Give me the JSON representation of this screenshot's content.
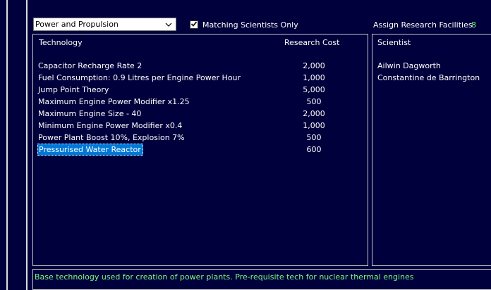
{
  "filter": {
    "selected": "Power and Propulsion",
    "matching_only_checked": true,
    "matching_only_label": "Matching Scientists Only"
  },
  "facilities": {
    "label": "Assign Research Facilities",
    "count": "8"
  },
  "tech_table": {
    "headers": {
      "technology": "Technology",
      "cost": "Research Cost"
    },
    "rows": [
      {
        "name": "Capacitor Recharge Rate 2",
        "cost": "2,000"
      },
      {
        "name": "Fuel Consumption: 0.9 Litres per Engine Power Hour",
        "cost": "1,000"
      },
      {
        "name": "Jump Point Theory",
        "cost": "5,000"
      },
      {
        "name": "Maximum Engine Power Modifier x1.25",
        "cost": "500"
      },
      {
        "name": "Maximum Engine Size - 40",
        "cost": "2,000"
      },
      {
        "name": "Minimum Engine Power Modifier x0.4",
        "cost": "1,000"
      },
      {
        "name": "Power Plant Boost 10%, Explosion 7%",
        "cost": "500"
      },
      {
        "name": "Pressurised Water Reactor",
        "cost": "600"
      }
    ],
    "selected_row": "Pressurised Water Reactor"
  },
  "scientists": {
    "header": "Scientist",
    "names": [
      "Ailwin Dagworth",
      "Constantine de Barrington"
    ]
  },
  "description": "Base technology used for creation of power plants. Pre-requisite tech for nuclear thermal engines",
  "colors": {
    "background": "#00003c",
    "highlight_text": "#7cfc7c",
    "selection": "#0078d7"
  },
  "icons": [
    "chevron-down-icon",
    "checkmark-icon"
  ]
}
